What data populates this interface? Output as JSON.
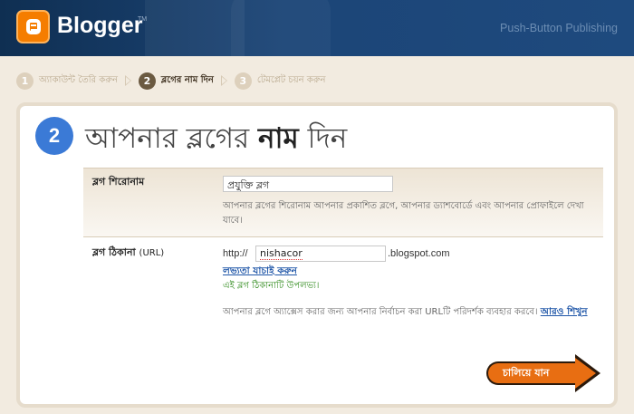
{
  "header": {
    "brand": "Blogger",
    "tm": "TM",
    "tagline": "Push-Button Publishing"
  },
  "steps": [
    {
      "num": "1",
      "label": "অ্যাকাউন্ট তৈরি করুন"
    },
    {
      "num": "2",
      "label": "ব্লগের নাম দিন"
    },
    {
      "num": "3",
      "label": "টেমপ্লেট চয়ন করুন"
    }
  ],
  "page": {
    "step_num": "2",
    "title_pre": "আপনার ব্লগের",
    "title_bold": "নাম",
    "title_post": "দিন"
  },
  "blog_title": {
    "label": "ব্লগ শিরোনাম",
    "value": "প্রযুক্তি ব্লগ",
    "help": "আপনার ব্লগের শিরোনাম আপনার প্রকাশিত ব্লগে, আপনার ড্যাশবোর্ডে এবং আপনার প্রোফাইলে দেখা যাবে।"
  },
  "blog_address": {
    "label": "ব্লগ ঠিকানা",
    "label_suffix": "(URL)",
    "prefix": "http://",
    "value": "nishacor",
    "suffix": ".blogspot.com",
    "check_link": "লভ্যতা যাচাই করুন",
    "available": "এই ব্লগ ঠিকানাটি উপলভ্য।",
    "help": "আপনার ব্লগে অ্যাক্সেস করার জন্য আপনার নির্বাচন করা URLটি পরিদর্শক ব্যবহার করবে।",
    "learn_more": "আরও শিখুন"
  },
  "continue_label": "চালিয়ে যান",
  "colors": {
    "header_bg": "#1c4577",
    "accent_orange": "#e86e12",
    "step_blue": "#3b7ad6",
    "link_blue": "#1f56a8",
    "available_green": "#2f8a1b"
  }
}
